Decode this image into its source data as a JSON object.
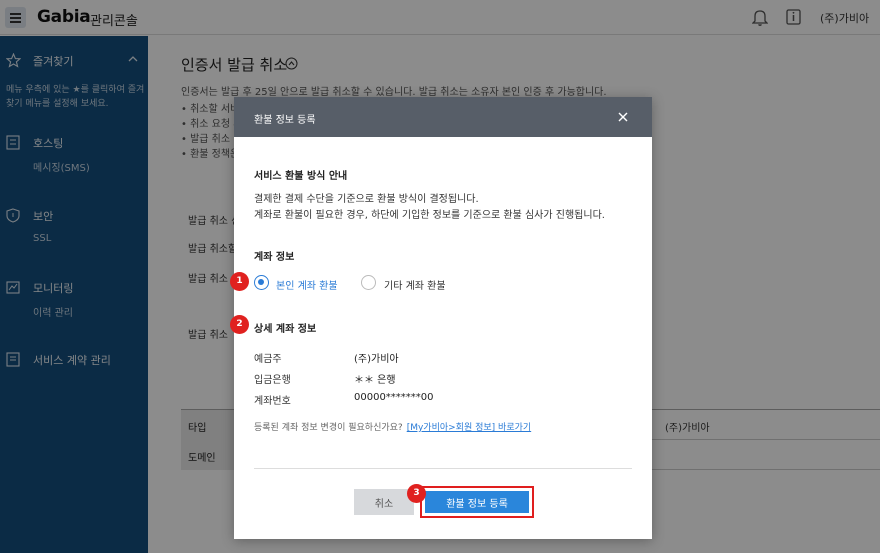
{
  "header": {
    "brand": "Gabia",
    "console": "관리콘솔",
    "user": "(주)가비아"
  },
  "sidebar": {
    "favorites": {
      "title": "즐겨찾기",
      "desc": "메뉴 우측에 있는 ★를 클릭하여 즐겨찾기 메뉴를 설정해 보세요."
    },
    "hosting": {
      "title": "호스팅",
      "sub": "메시징(SMS)"
    },
    "security": {
      "title": "보안",
      "sub": "SSL"
    },
    "monitoring": {
      "title": "모니터링",
      "sub": "이력 관리"
    },
    "contract": {
      "title": "서비스 계약 관리"
    }
  },
  "page": {
    "title": "인증서 발급 취소",
    "desc": "인증서는 발급 후 25일 안으로 발급 취소할 수 있습니다. 발급 취소는 소유자 본인 인증 후 가능합니다.",
    "bullets": [
      "• 취소할 서비",
      "• 취소 요청 후",
      "• 발급 취소",
      "• 환불 정책은"
    ],
    "rows": [
      "발급 취소 신",
      "발급 취소할",
      "발급 취소",
      "발급 취소"
    ],
    "table": {
      "type_label": "타입",
      "type_value": "(주)가비아",
      "domain_label": "도메인"
    }
  },
  "modal": {
    "title": "환불 정보 등록",
    "guide_title": "서비스 환불 방식 안내",
    "guide_line1": "결제한 결제 수단을 기준으로 환불 방식이 결정됩니다.",
    "guide_line2": "계좌로 환불이 필요한 경우, 하단에 기입한 정보를 기준으로 환불 심사가 진행됩니다.",
    "account_title": "계좌 정보",
    "option_own": "본인 계좌 환불",
    "option_other": "기타 계좌 환불",
    "detail_title": "상세 계좌 정보",
    "holder_label": "예금주",
    "holder_value": "(주)가비아",
    "bank_label": "입금은행",
    "bank_value": "＊＊ 은행",
    "number_label": "계좌번호",
    "number_value": "00000*******00",
    "help_text": "등록된 계좌 정보 변경이 필요하신가요?",
    "help_link": "[My가비아>회원 정보] 바로가기",
    "cancel_label": "취소",
    "submit_label": "환불 정보 등록"
  },
  "badges": [
    "1",
    "2",
    "3"
  ],
  "colors": {
    "sidebar": "#144f7e",
    "modal_header": "#575e68",
    "primary": "#2a86db",
    "highlight": "#e01e1e"
  }
}
